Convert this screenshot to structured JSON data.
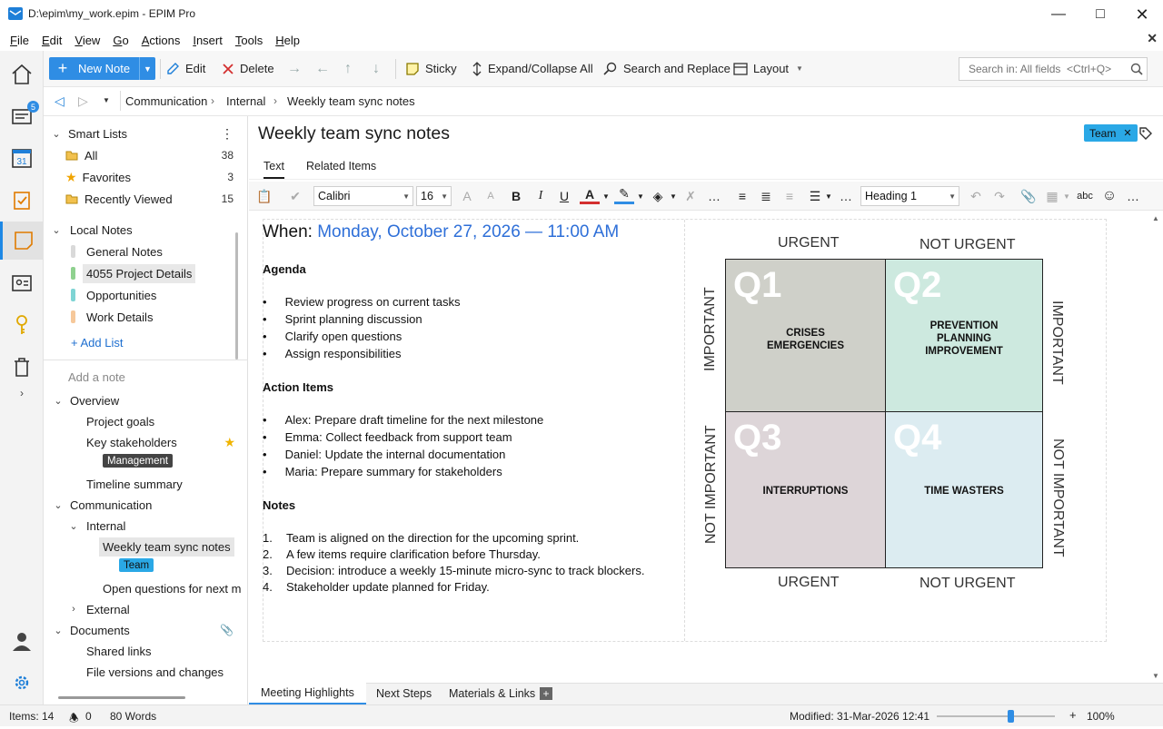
{
  "window": {
    "title": "D:\\epim\\my_work.epim - EPIM Pro"
  },
  "menu": {
    "items": [
      "File",
      "Edit",
      "View",
      "Go",
      "Actions",
      "Insert",
      "Tools",
      "Help"
    ],
    "accel": [
      "F",
      "E",
      "V",
      "G",
      "A",
      "I",
      "T",
      "H"
    ]
  },
  "rail": {
    "badge": "5",
    "calendar_day": "31"
  },
  "toolbar": {
    "new_note": "New Note",
    "edit": "Edit",
    "delete": "Delete",
    "sticky": "Sticky",
    "expand": "Expand/Collapse All",
    "search_replace": "Search and Replace",
    "layout": "Layout",
    "search_placeholder": "Search in: All fields  <Ctrl+Q>"
  },
  "breadcrumb": [
    "Communication",
    "Internal",
    "Weekly team sync notes"
  ],
  "sidebar": {
    "smart_lists": {
      "header": "Smart Lists",
      "items": [
        {
          "label": "All",
          "count": "38"
        },
        {
          "label": "Favorites",
          "count": "3"
        },
        {
          "label": "Recently Viewed",
          "count": "15"
        }
      ]
    },
    "local_notes": {
      "header": "Local Notes",
      "items": [
        {
          "label": "General Notes",
          "color": "#d9d9d9"
        },
        {
          "label": "4055 Project Details",
          "color": "#8fd18f"
        },
        {
          "label": "Opportunities",
          "color": "#7fd4d4"
        },
        {
          "label": "Work Details",
          "color": "#f6c89a"
        }
      ],
      "add_list": "+ Add List"
    },
    "add_note_placeholder": "Add a note",
    "tree": {
      "overview": "Overview",
      "project_goals": "Project goals",
      "key_stakeholders": "Key stakeholders",
      "management_tag": "Management",
      "timeline_summary": "Timeline summary",
      "communication": "Communication",
      "internal": "Internal",
      "weekly_sync": "Weekly team sync notes",
      "team_tag": "Team",
      "open_questions": "Open questions for next m",
      "external": "External",
      "documents": "Documents",
      "shared_links": "Shared links",
      "file_versions": "File versions and changes"
    }
  },
  "note": {
    "title": "Weekly team sync notes",
    "tag": "Team",
    "tabs": [
      "Text",
      "Related Items"
    ],
    "format": {
      "font": "Calibri",
      "size": "16",
      "style": "Heading 1",
      "spell": "abc"
    },
    "when_label": "When:",
    "when_value": "Monday, October 27, 2026 — 11:00 AM",
    "agenda_heading": "Agenda",
    "agenda": [
      "Review progress on current tasks",
      "Sprint planning discussion",
      "Clarify open questions",
      "Assign responsibilities"
    ],
    "actions_heading": "Action Items",
    "actions": [
      "Alex: Prepare draft timeline for the next milestone",
      "Emma: Collect feedback from support team",
      "Daniel: Update the internal documentation",
      "Maria: Prepare summary for stakeholders"
    ],
    "notes_heading": "Notes",
    "notes": [
      "Team is aligned on the direction for the upcoming sprint.",
      "A few items require clarification before Thursday.",
      "Decision: introduce a weekly 15-minute micro-sync to track blockers.",
      "Stakeholder update planned for Friday."
    ],
    "numbers": [
      "1.",
      "2.",
      "3.",
      "4."
    ]
  },
  "matrix": {
    "top_left": "URGENT",
    "top_right": "NOT URGENT",
    "bottom_left": "URGENT",
    "bottom_right": "NOT URGENT",
    "left_top": "IMPORTANT",
    "left_bottom": "NOT IMPORTANT",
    "right_top": "IMPORTANT",
    "right_bottom": "NOT IMPORTANT",
    "q1": {
      "num": "Q1",
      "lines": [
        "CRISES",
        "EMERGENCIES"
      ],
      "color": "#cfd0c9"
    },
    "q2": {
      "num": "Q2",
      "lines": [
        "PREVENTION",
        "PLANNING",
        "IMPROVEMENT"
      ],
      "color": "#cde9df"
    },
    "q3": {
      "num": "Q3",
      "lines": [
        "INTERRUPTIONS"
      ],
      "color": "#ddd5d8"
    },
    "q4": {
      "num": "Q4",
      "lines": [
        "TIME WASTERS"
      ],
      "color": "#dcecf1"
    }
  },
  "bottom_tabs": [
    "Meeting Highlights",
    "Next Steps",
    "Materials & Links"
  ],
  "status": {
    "items": "Items: 14",
    "alerts": "0",
    "words": "80 Words",
    "modified": "Modified: 31-Mar-2026 12:41",
    "zoom": "100%"
  }
}
